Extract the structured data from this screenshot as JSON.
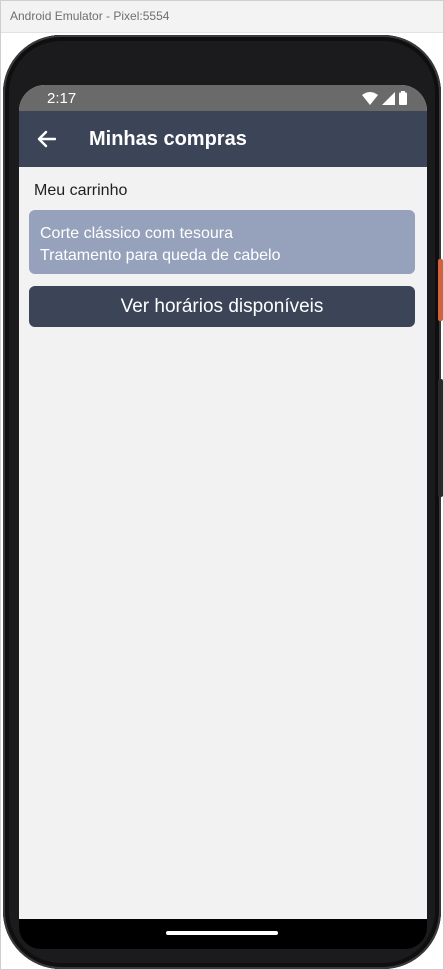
{
  "window": {
    "title": "Android Emulator - Pixel:5554"
  },
  "status_bar": {
    "time": "2:17",
    "icons": [
      "wifi-icon",
      "cell-signal-icon",
      "battery-icon"
    ]
  },
  "app_bar": {
    "back_icon": "arrow-left-icon",
    "title": "Minhas compras"
  },
  "cart": {
    "section_title": "Meu carrinho",
    "items": [
      {
        "label": "Corte clássico com tesoura"
      },
      {
        "label": "Tratamento para queda de cabelo"
      }
    ]
  },
  "actions": {
    "view_schedules_label": "Ver horários disponíveis"
  },
  "colors": {
    "app_bar": "#3c4558",
    "card": "#96a2bb",
    "screen_background": "#f2f2f2",
    "status_bar": "#6a6a6a",
    "side_button_accent": "#d4613c"
  }
}
